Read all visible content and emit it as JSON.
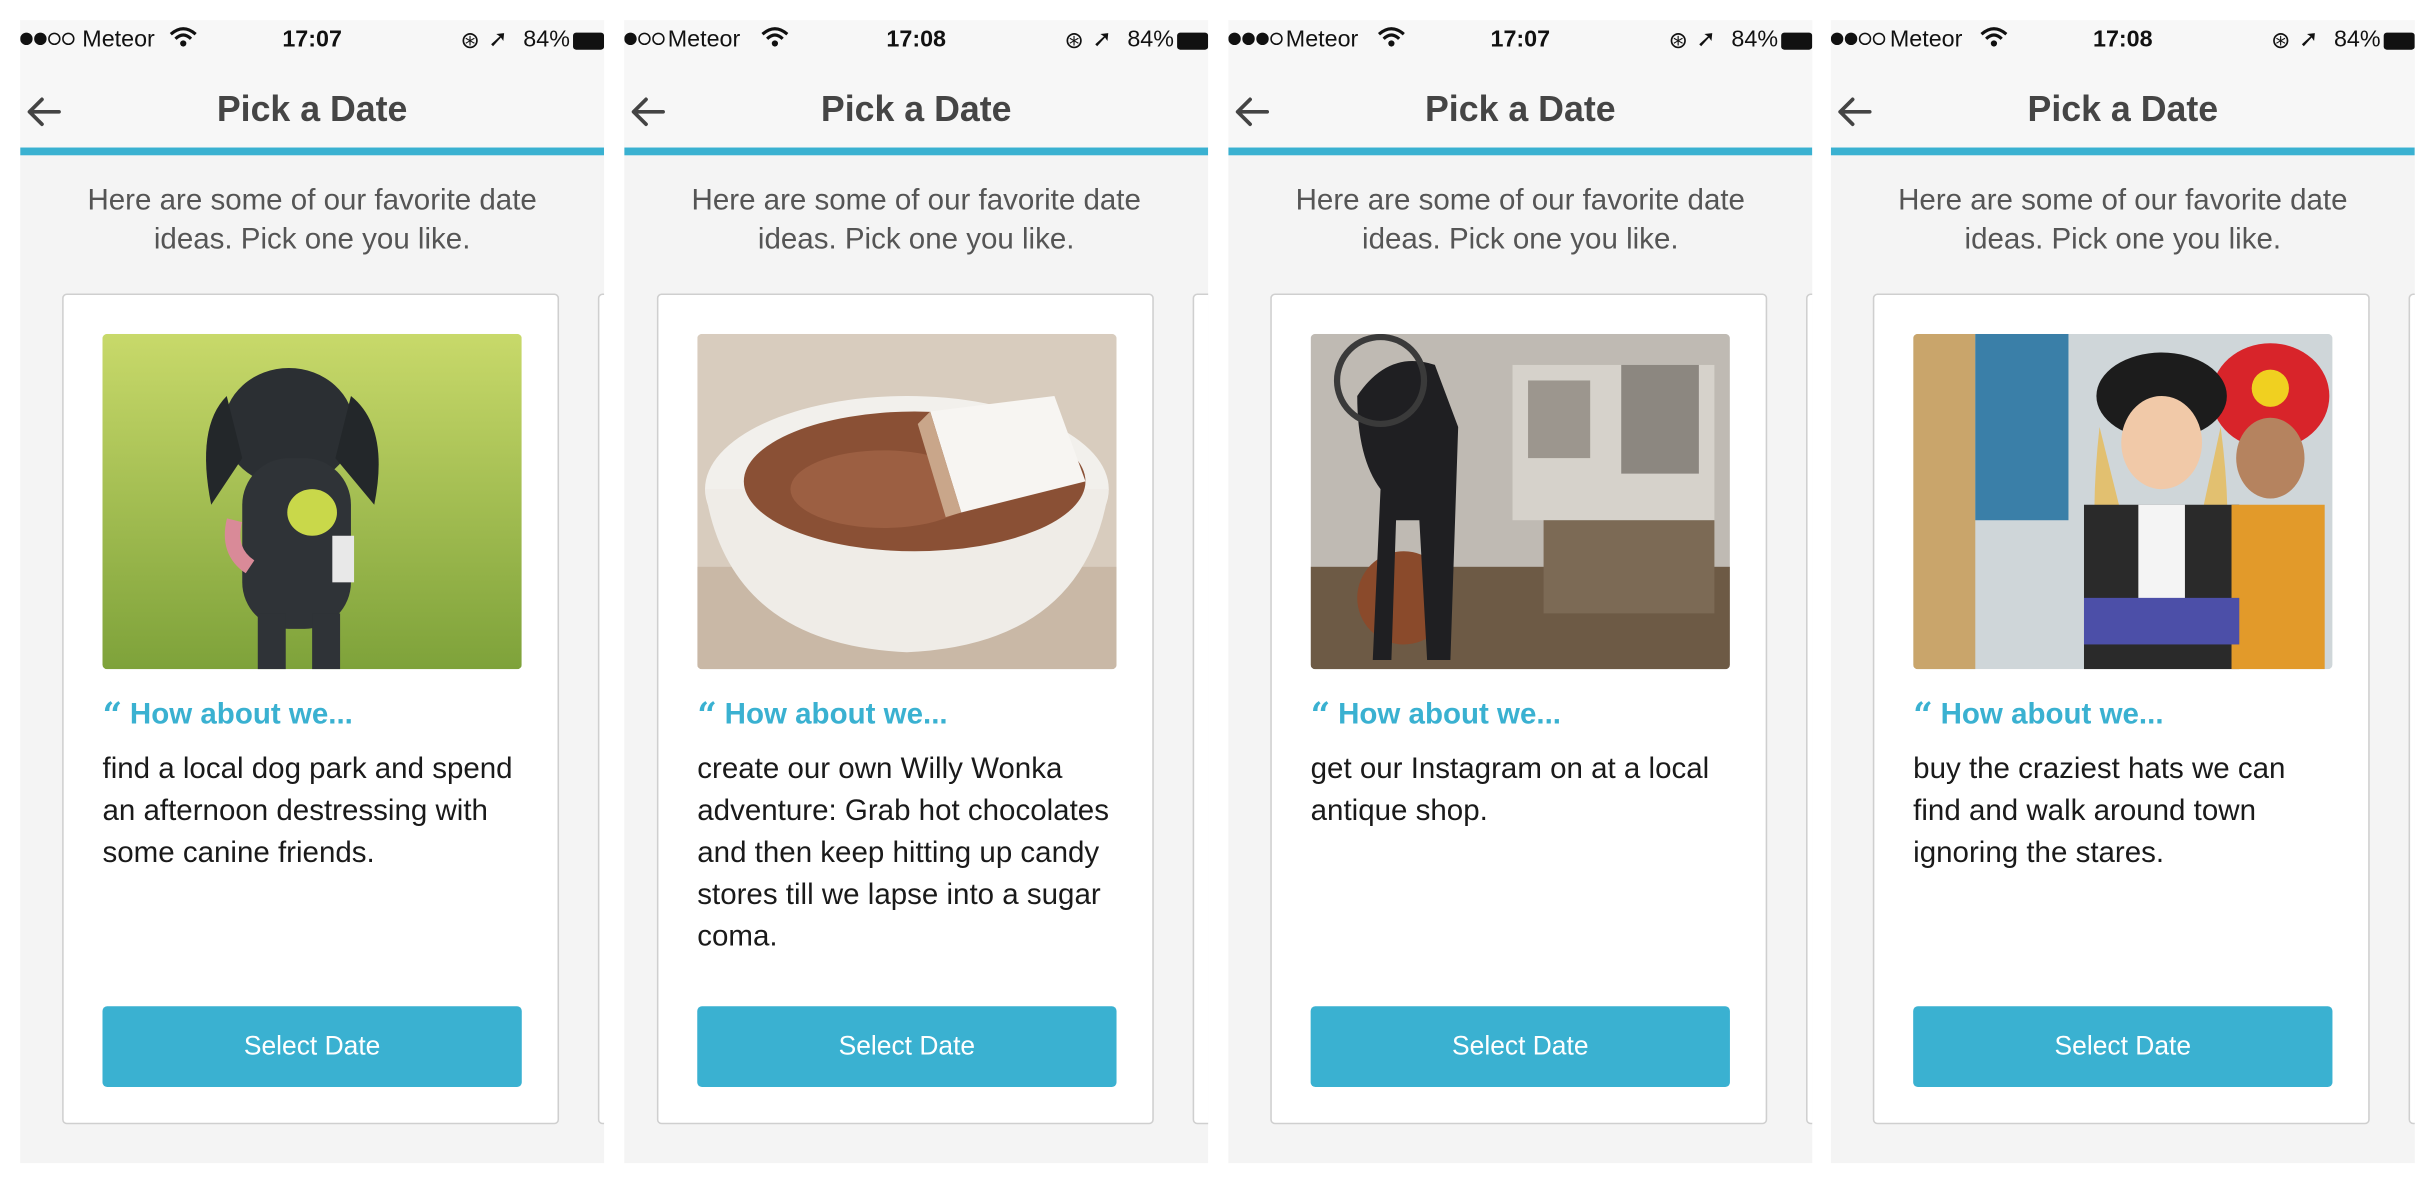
{
  "screens": [
    {
      "status": {
        "carrier": "Meteor",
        "time": "17:07",
        "battery": "84%"
      },
      "nav": {
        "title": "Pick a Date"
      },
      "intro": "Here are some of our favorite date ideas. Pick one you like.",
      "card": {
        "quote_label": "How about we...",
        "idea": "find a local dog park and spend an afternoon destressing with some canine friends.",
        "button": "Select Date",
        "image": "black-dog-with-tennis-ball"
      }
    },
    {
      "status": {
        "carrier": "Meteor",
        "time": "17:08",
        "battery": "84%"
      },
      "nav": {
        "title": "Pick a Date"
      },
      "intro": "Here are some of our favorite date ideas. Pick one you like.",
      "card": {
        "quote_label": "How about we...",
        "idea": "create our own Willy Wonka adventure: Grab hot chocolates and then keep hitting up candy stores till we lapse into a sugar coma.",
        "button": "Select Date",
        "image": "hot-chocolate-with-marshmallow"
      }
    },
    {
      "status": {
        "carrier": "Meteor",
        "time": "17:07",
        "battery": "84%"
      },
      "nav": {
        "title": "Pick a Date"
      },
      "intro": "Here are some of our favorite date ideas. Pick one you like.",
      "card": {
        "quote_label": "How about we...",
        "idea": "get our Instagram on at a local antique shop.",
        "button": "Select Date",
        "image": "antique-shop-with-horse-statue"
      }
    },
    {
      "status": {
        "carrier": "Meteor",
        "time": "17:08",
        "battery": "84%"
      },
      "nav": {
        "title": "Pick a Date"
      },
      "intro": "Here are some of our favorite date ideas. Pick one you like.",
      "card": {
        "quote_label": "How about we...",
        "idea": "buy the craziest hats we can find and walk around town ignoring the stares.",
        "button": "Select Date",
        "image": "two-women-in-hats"
      }
    }
  ],
  "colors": {
    "accent": "#3ab1d1",
    "background": "#f4f4f4"
  }
}
